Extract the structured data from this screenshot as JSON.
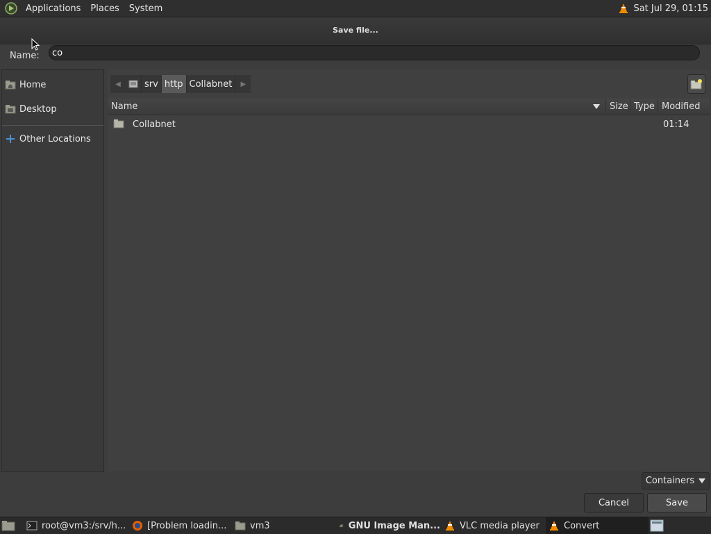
{
  "top_panel": {
    "menus": [
      "Applications",
      "Places",
      "System"
    ],
    "clock": "Sat Jul 29, 01:15",
    "tray_icon": "vlc-cone-icon"
  },
  "dialog": {
    "title": "Save file...",
    "name_label": "Name:",
    "name_value": "co",
    "sidebar": {
      "items": [
        {
          "label": "Home",
          "icon": "home-folder-icon"
        },
        {
          "label": "Desktop",
          "icon": "desktop-folder-icon"
        },
        {
          "label": "Other Locations",
          "icon": "plus-icon"
        }
      ]
    },
    "pathbar": {
      "segments": [
        {
          "label": "srv"
        },
        {
          "label": "http"
        },
        {
          "label": "Collabnet"
        }
      ],
      "active_index": 1
    },
    "columns": {
      "name": "Name",
      "size": "Size",
      "type": "Type",
      "modified": "Modified"
    },
    "files": [
      {
        "name": "Collabnet",
        "size": "",
        "type": "",
        "modified": "01:14",
        "icon": "folder-icon"
      }
    ],
    "filter": {
      "selected": "Containers"
    },
    "buttons": {
      "cancel": "Cancel",
      "save": "Save"
    }
  },
  "taskbar": {
    "tasks": [
      {
        "label": "root@vm3:/srv/h...",
        "icon": "terminal-icon"
      },
      {
        "label": "[Problem loadin...",
        "icon": "firefox-icon"
      },
      {
        "label": "vm3",
        "icon": "folder-icon"
      },
      {
        "label": "GNU Image Man...",
        "icon": "gimp-icon"
      },
      {
        "label": "VLC media player",
        "icon": "vlc-cone-icon"
      },
      {
        "label": "Convert",
        "icon": "vlc-cone-icon"
      }
    ],
    "active_task": "Convert"
  },
  "colors": {
    "panel": "#2f2f2f",
    "dialog_bg": "#3d3d3d",
    "vlc_orange": "#f08a00"
  }
}
